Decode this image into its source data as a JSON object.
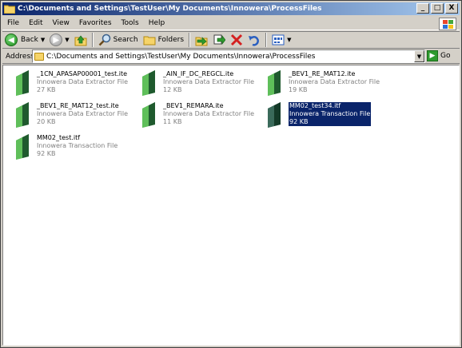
{
  "window": {
    "title": "C:\\Documents and Settings\\TestUser\\My Documents\\Innowera\\ProcessFiles",
    "controls": {
      "minimize": "_",
      "maximize": "□",
      "close": "X"
    }
  },
  "menu": {
    "items": [
      {
        "label": "File"
      },
      {
        "label": "Edit"
      },
      {
        "label": "View"
      },
      {
        "label": "Favorites"
      },
      {
        "label": "Tools"
      },
      {
        "label": "Help"
      }
    ]
  },
  "toolbar": {
    "back_label": "Back",
    "search_label": "Search",
    "folders_label": "Folders"
  },
  "address": {
    "label": "Address",
    "path": "C:\\Documents and Settings\\TestUser\\My Documents\\Innowera\\ProcessFiles",
    "go_label": "Go"
  },
  "files": [
    {
      "name": "_1CN_APASAP00001_test.ite",
      "type": "Innowera Data Extractor File",
      "size": "27 KB",
      "selected": false
    },
    {
      "name": "_AIN_IF_DC_REGCL.ite",
      "type": "Innowera Data Extractor File",
      "size": "12 KB",
      "selected": false
    },
    {
      "name": "_BEV1_RE_MAT12.ite",
      "type": "Innowera Data Extractor File",
      "size": "19 KB",
      "selected": false
    },
    {
      "name": "_BEV1_RE_MAT12_test.ite",
      "type": "Innowera Data Extractor File",
      "size": "20 KB",
      "selected": false
    },
    {
      "name": "_BEV1_REMARA.ite",
      "type": "Innowera Data Extractor File",
      "size": "11 KB",
      "selected": false
    },
    {
      "name": "MM02_test34.itf",
      "type": "Innowera Transaction File",
      "size": "92 KB",
      "selected": true
    },
    {
      "name": "MM02_test.itf",
      "type": "Innowera Transaction File",
      "size": "92 KB",
      "selected": false
    }
  ],
  "colors": {
    "title_gradient_start": "#0a246a",
    "title_gradient_end": "#a6caf0",
    "selection": "#0a246a",
    "icon_green": "#2e8b3e",
    "icon_dark": "#1f5a2e"
  }
}
